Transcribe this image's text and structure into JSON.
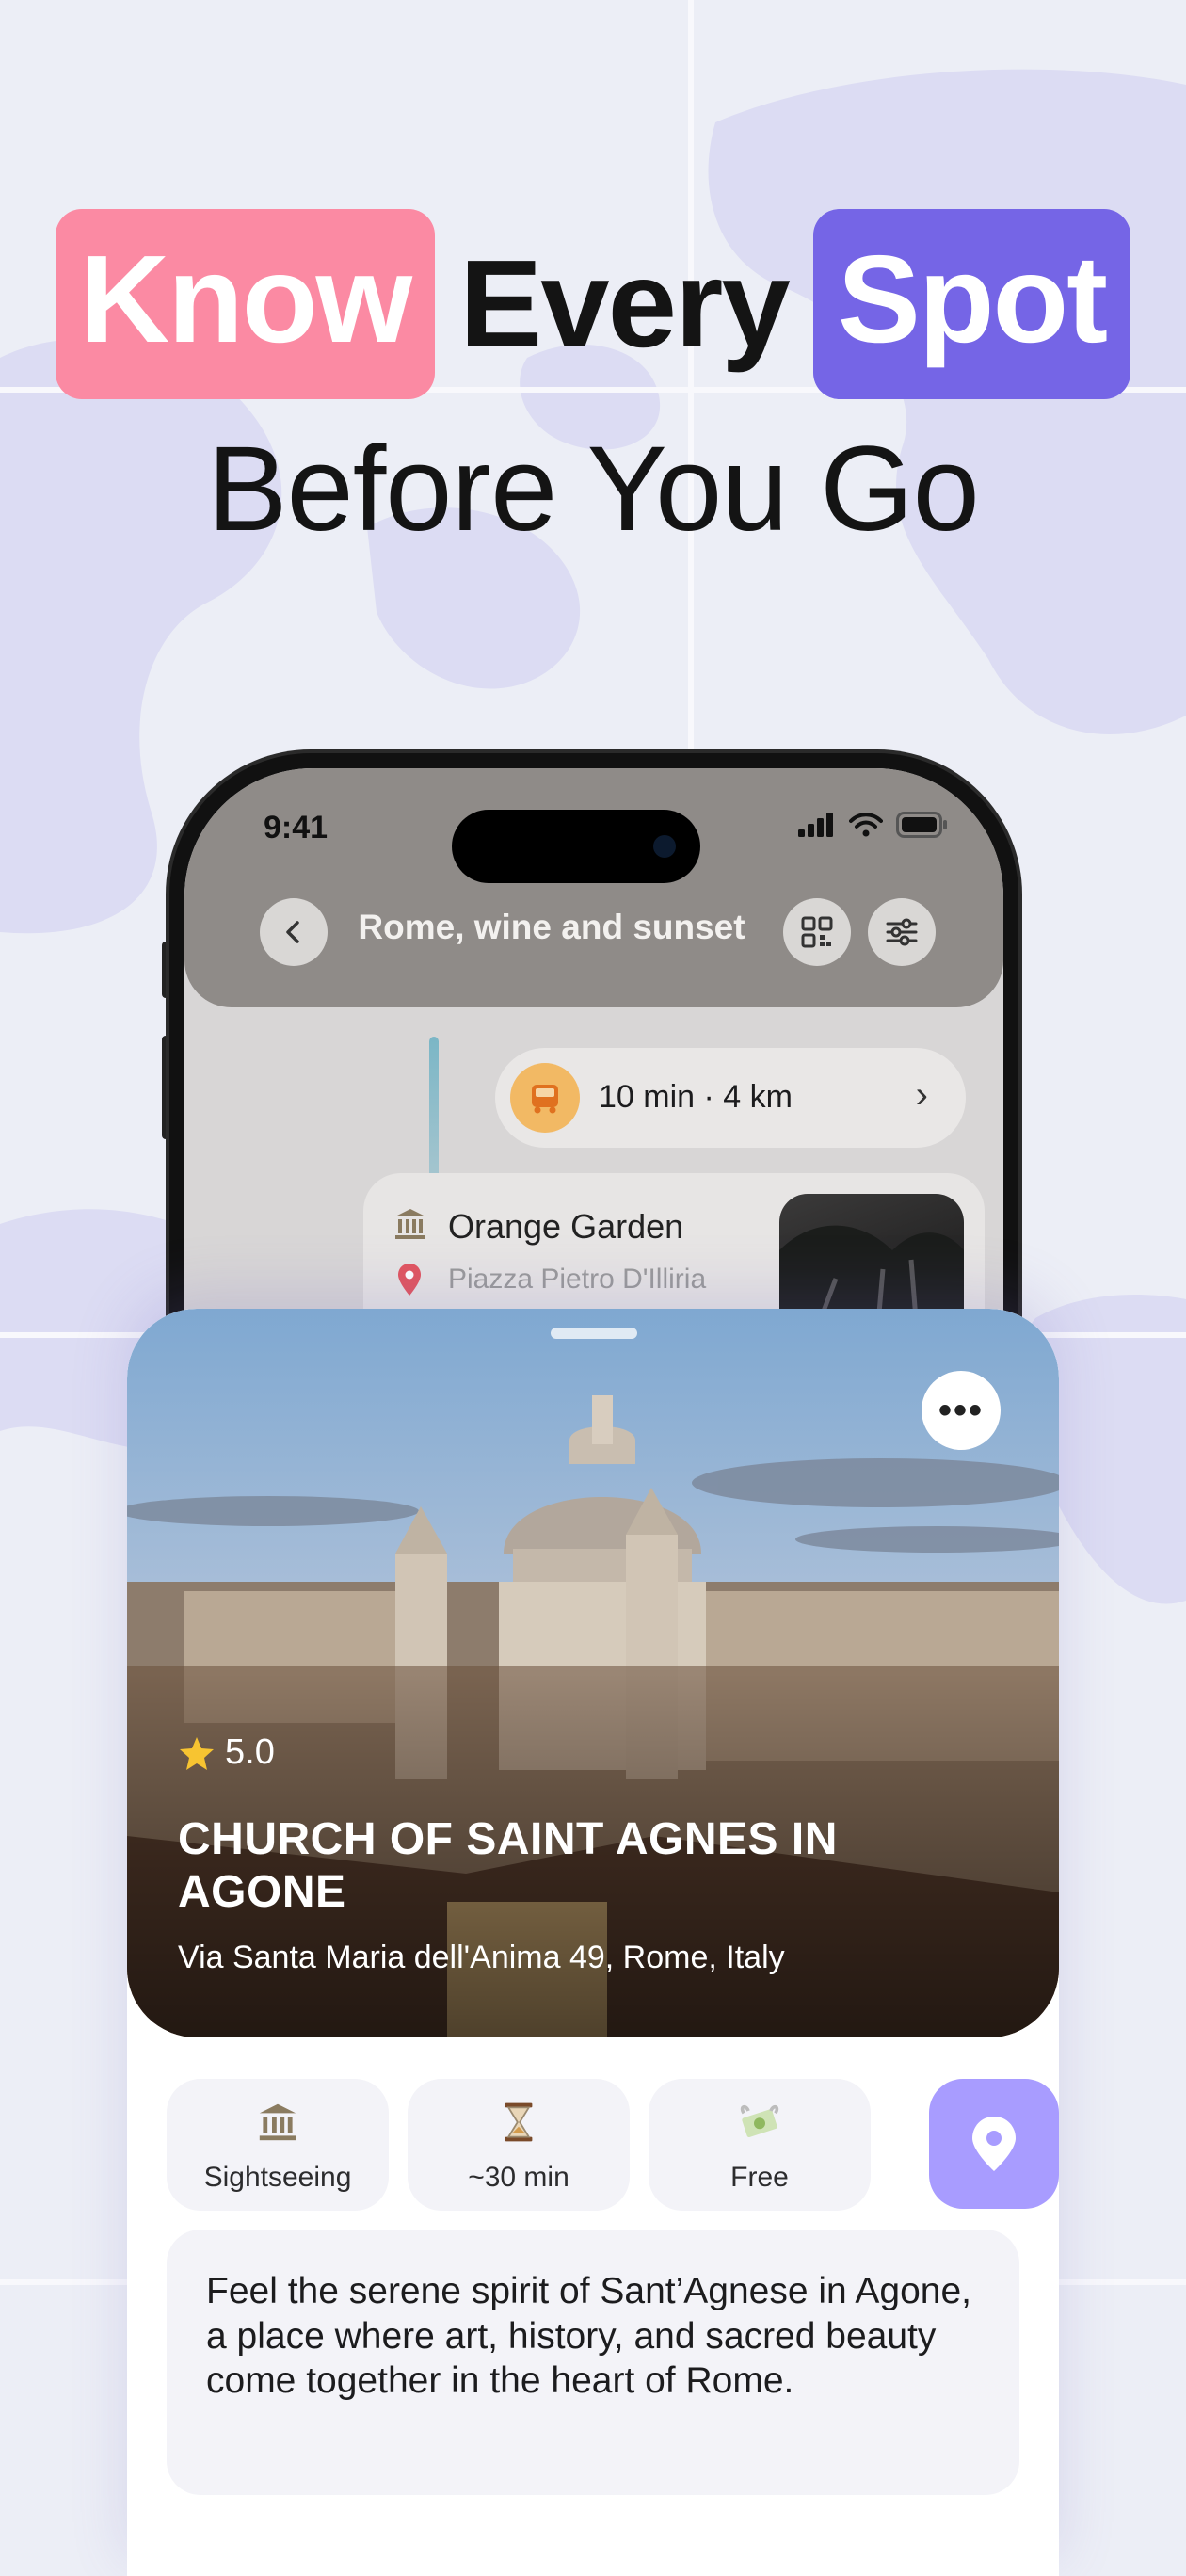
{
  "headline": {
    "word1": "Know",
    "word2": "Every",
    "word3": "Spot",
    "line2": "Before You Go",
    "accent_pink": "#fb8aa3",
    "accent_purple": "#7565e6"
  },
  "phone": {
    "status": {
      "time": "9:41",
      "icons": [
        "signal-icon",
        "wifi-icon",
        "battery-icon"
      ]
    },
    "header": {
      "title": "Rome, wine and sunset",
      "back_icon": "chevron-left-icon",
      "qr_icon": "qr-code-icon",
      "filter_icon": "sliders-icon"
    },
    "route": {
      "text": "10 min · 4 km",
      "icon": "bus-icon"
    },
    "place": {
      "name": "Orange Garden",
      "address": "Piazza Pietro D'Illiria"
    }
  },
  "detail": {
    "rating": "5.0",
    "title": "CHURCH OF SAINT AGNES IN AGONE",
    "address": "Via Santa Maria dell'Anima 49, Rome, Italy",
    "chips": [
      {
        "icon": "museum-icon",
        "label": "Sightseeing"
      },
      {
        "icon": "hourglass-icon",
        "label": "~30 min"
      },
      {
        "icon": "money-icon",
        "label": "Free"
      }
    ],
    "pin_icon": "map-pin-icon",
    "description": "Feel the serene spirit of Sant’Agnese in Agone, a place where art, history, and sacred beauty come together in the heart of Rome."
  }
}
